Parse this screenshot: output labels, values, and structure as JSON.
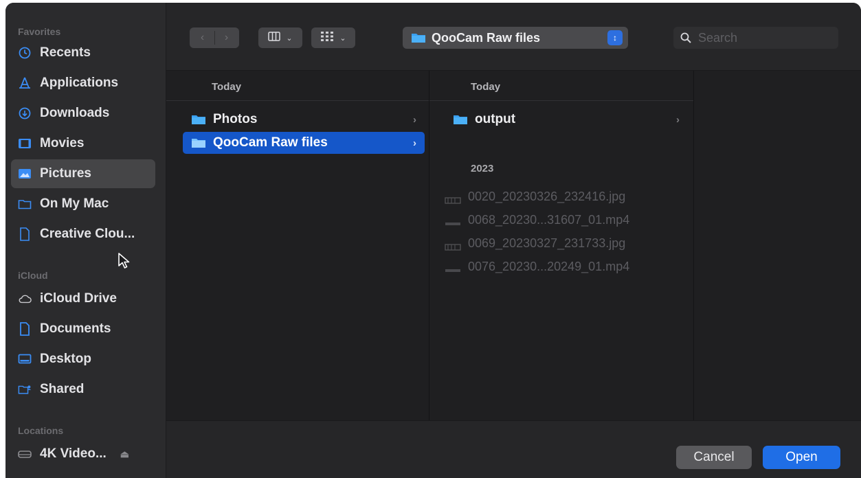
{
  "sidebar": {
    "sections": [
      {
        "label": "Favorites"
      },
      {
        "label": "iCloud"
      },
      {
        "label": "Locations"
      }
    ],
    "favorites": [
      {
        "label": "Recents",
        "icon": "clock-icon"
      },
      {
        "label": "Applications",
        "icon": "applications-icon"
      },
      {
        "label": "Downloads",
        "icon": "download-icon"
      },
      {
        "label": "Movies",
        "icon": "film-icon"
      },
      {
        "label": "Pictures",
        "icon": "photo-icon"
      },
      {
        "label": "On My Mac",
        "icon": "folder-icon"
      },
      {
        "label": "Creative Clou...",
        "icon": "document-icon"
      }
    ],
    "icloud": [
      {
        "label": "iCloud Drive",
        "icon": "cloud-icon"
      },
      {
        "label": "Documents",
        "icon": "document-icon"
      },
      {
        "label": "Desktop",
        "icon": "desktop-icon"
      },
      {
        "label": "Shared",
        "icon": "shared-folder-icon"
      }
    ],
    "locations": [
      {
        "label": "4K Video...",
        "icon": "drive-icon"
      }
    ],
    "selected": "Pictures"
  },
  "toolbar": {
    "path_label": "QooCam Raw files",
    "search_placeholder": "Search"
  },
  "columns": {
    "col1_header": "Today",
    "col1_items": [
      {
        "label": "Photos"
      },
      {
        "label": "QooCam Raw files"
      }
    ],
    "col2_header": "Today",
    "col2_folder": "output",
    "col2_group": "2023",
    "col2_files": [
      {
        "label": "0020_20230326_232416.jpg",
        "icon": "image-file-icon"
      },
      {
        "label": "0068_20230...31607_01.mp4",
        "icon": "video-file-icon"
      },
      {
        "label": "0069_20230327_231733.jpg",
        "icon": "image-file-icon"
      },
      {
        "label": "0076_20230...20249_01.mp4",
        "icon": "video-file-icon"
      }
    ]
  },
  "footer": {
    "cancel_label": "Cancel",
    "open_label": "Open"
  },
  "colors": {
    "accent": "#1f6ee6",
    "selection": "#1557c9",
    "sidebar_icon": "#3b8df5"
  }
}
